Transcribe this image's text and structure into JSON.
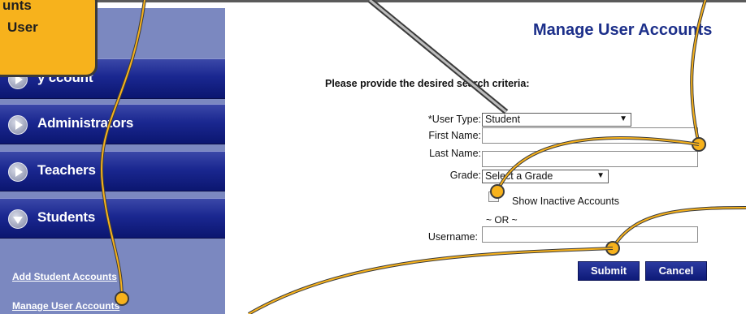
{
  "callout": {
    "line1": "unts",
    "line2": "User"
  },
  "sidebar": {
    "items": [
      {
        "label": "y  ccount",
        "icon": "arrow-right-icon"
      },
      {
        "label": "Administrators",
        "icon": "arrow-right-icon"
      },
      {
        "label": "Teachers",
        "icon": "arrow-right-icon"
      },
      {
        "label": "Students",
        "icon": "arrow-down-icon"
      }
    ],
    "links": [
      {
        "label": "Add Student Accounts"
      },
      {
        "label": "Manage User Accounts"
      }
    ]
  },
  "form": {
    "title": "Manage User Accounts",
    "criteria_prompt": "Please provide the desired search criteria:",
    "user_type_label": "*User Type:",
    "user_type_value": "Student",
    "first_name_label": "First Name:",
    "first_name_value": "",
    "last_name_label": "Last Name:",
    "last_name_value": "",
    "grade_label": "Grade:",
    "grade_value": "Select a Grade",
    "show_inactive_label": "Show Inactive Accounts",
    "show_inactive_checked": false,
    "or_separator": "~ OR ~",
    "username_label": "Username:",
    "username_value": "",
    "submit_label": "Submit",
    "cancel_label": "Cancel"
  },
  "colors": {
    "sidebar_bg": "#7b88c0",
    "nav_item": "#1a2790",
    "title": "#1c2f8a",
    "callout": "#f7b21c",
    "annotation_line": "#f7b21c"
  }
}
